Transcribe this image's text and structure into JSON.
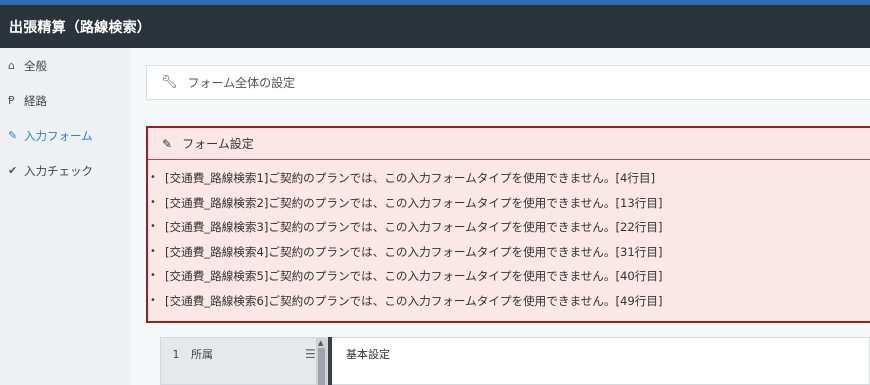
{
  "window": {
    "title": "出張精算（路線検索）"
  },
  "sidebar": {
    "items": [
      {
        "icon": "home-icon",
        "glyph": "⌂",
        "label": "全般",
        "active": false
      },
      {
        "icon": "yen-icon",
        "glyph": "Ᵽ",
        "label": "経路",
        "active": false
      },
      {
        "icon": "pencil-icon",
        "glyph": "✎",
        "label": "入力フォーム",
        "active": true
      },
      {
        "icon": "check-icon",
        "glyph": "✔",
        "label": "入力チェック",
        "active": false
      }
    ]
  },
  "main": {
    "form_settings_label": "フォーム全体の設定",
    "form_settings_icon": "wrench-icon",
    "error_panel": {
      "title": "フォーム設定",
      "title_icon": "pencil-icon",
      "border_color": "#9a1f23",
      "background_color": "#fbe7e7",
      "errors": [
        "[交通費_路線検索1]ご契約のプランでは、この入力フォームタイプを使用できません。[4行目]",
        "[交通費_路線検索2]ご契約のプランでは、この入力フォームタイプを使用できません。[13行目]",
        "[交通費_路線検索3]ご契約のプランでは、この入力フォームタイプを使用できません。[22行目]",
        "[交通費_路線検索4]ご契約のプランでは、この入力フォームタイプを使用できません。[31行目]",
        "[交通費_路線検索5]ご契約のプランでは、この入力フォームタイプを使用できません。[40行目]",
        "[交通費_路線検索6]ご契約のプランでは、この入力フォームタイプを使用できません。[49行目]"
      ]
    },
    "field_list": [
      {
        "num": "1",
        "label": "所属"
      }
    ],
    "detail_title": "基本設定"
  },
  "colors": {
    "header_bg": "#2b333b",
    "top_accent": "#2a6db5",
    "active_sidebar": "#2a85c9"
  }
}
